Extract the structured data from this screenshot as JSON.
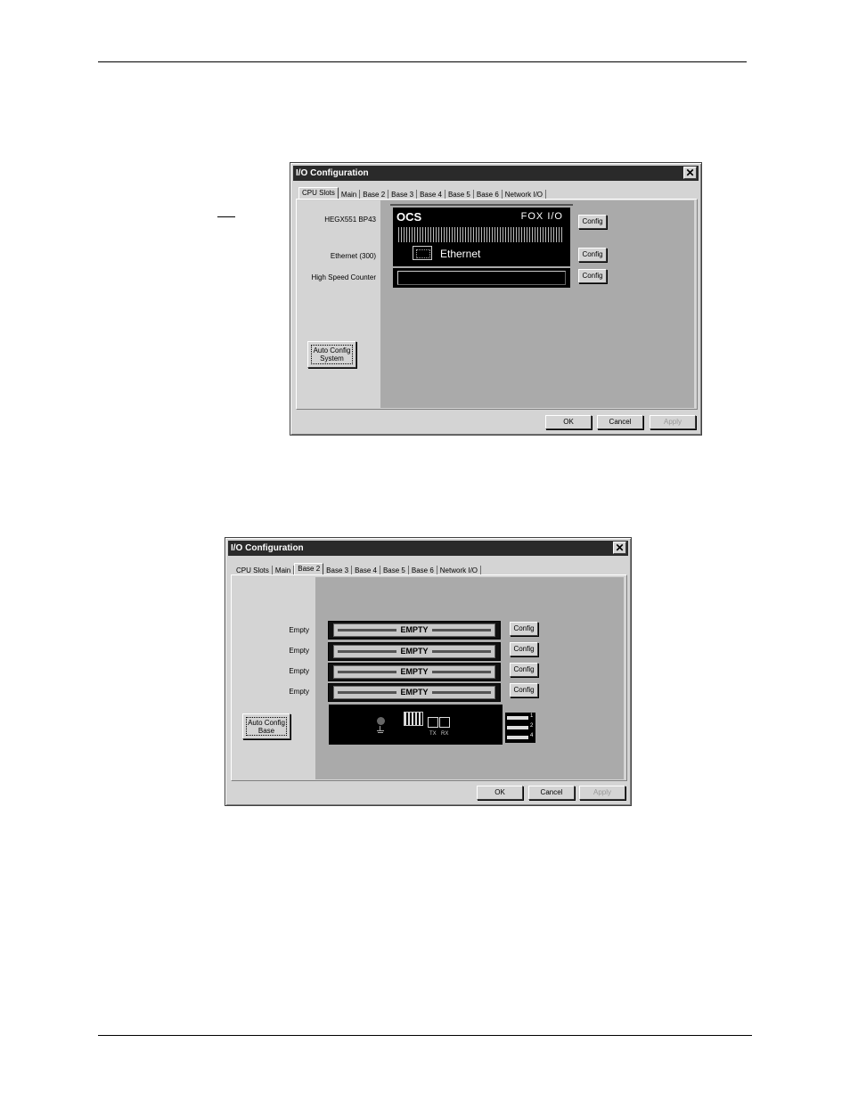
{
  "dialog1": {
    "title": "I/O Configuration",
    "close": "✕",
    "tabs": [
      "CPU Slots",
      "Main",
      "Base 2",
      "Base 3",
      "Base 4",
      "Base 5",
      "Base 6",
      "Network I/O"
    ],
    "active_tab": "CPU Slots",
    "rows": [
      {
        "label": "HEGX551 BP43",
        "button": "Config"
      },
      {
        "label": "Ethernet (300)",
        "button": "Config"
      },
      {
        "label": "High Speed Counter",
        "button": "Config"
      }
    ],
    "module": {
      "brand": "OCS",
      "product": "FOX I/O",
      "port_label": "Ethernet"
    },
    "auto_config": {
      "line1": "Auto Config",
      "line2": "System"
    },
    "ok": "OK",
    "cancel": "Cancel",
    "apply": "Apply"
  },
  "dialog2": {
    "title": "I/O Configuration",
    "close": "✕",
    "tabs": [
      "CPU Slots",
      "Main",
      "Base 2",
      "Base 3",
      "Base 4",
      "Base 5",
      "Base 6",
      "Network I/O"
    ],
    "active_tab": "Base 2",
    "slots": [
      {
        "label": "Empty",
        "text": "EMPTY",
        "button": "Config"
      },
      {
        "label": "Empty",
        "text": "EMPTY",
        "button": "Config"
      },
      {
        "label": "Empty",
        "text": "EMPTY",
        "button": "Config"
      },
      {
        "label": "Empty",
        "text": "EMPTY",
        "button": "Config"
      }
    ],
    "base_module": {
      "tx": "TX",
      "rx": "RX",
      "numbers": [
        "1",
        "2",
        "4"
      ]
    },
    "auto_config": {
      "line1": "Auto Config",
      "line2": "Base"
    },
    "ok": "OK",
    "cancel": "Cancel",
    "apply": "Apply"
  }
}
